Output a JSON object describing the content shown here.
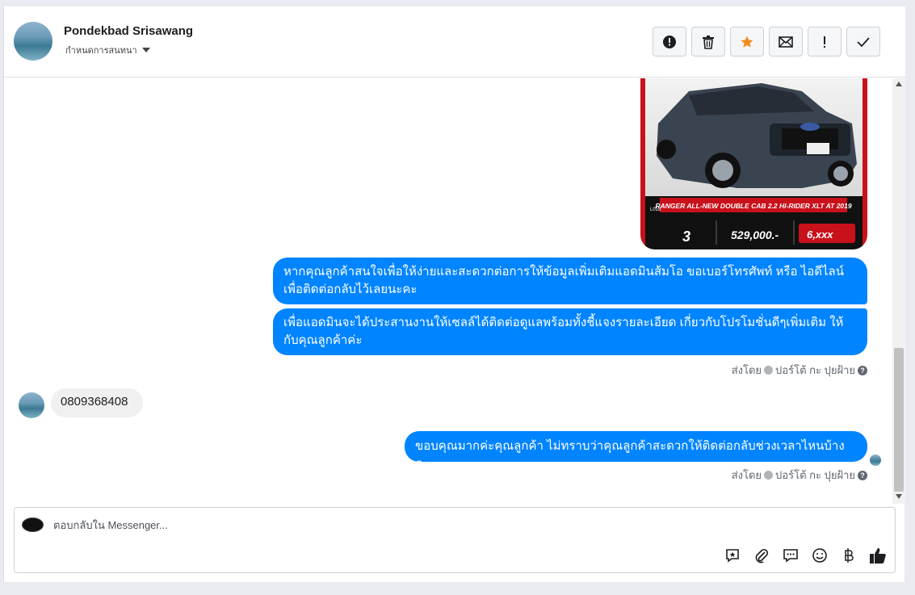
{
  "header": {
    "contact_name": "Pondekbad Srisawang",
    "assign_label": "กำหนดการสนทนา"
  },
  "actions": [
    {
      "name": "spam",
      "icon": "alert-circle-icon"
    },
    {
      "name": "delete",
      "icon": "trash-icon"
    },
    {
      "name": "star",
      "icon": "star-icon"
    },
    {
      "name": "mark-unread",
      "icon": "envelope-icon"
    },
    {
      "name": "important",
      "icon": "exclamation-icon"
    },
    {
      "name": "done",
      "icon": "check-icon"
    }
  ],
  "thread": {
    "promo_image": {
      "model_text": "RANGER ALL-NEW DOUBLE CAB 2.2 HI-RIDER XLT AT 2019",
      "price": "529,000.-",
      "years": "3",
      "down": "6,xxx",
      "code": "L018"
    },
    "outgoing_1": "หากคุณลูกค้าสนใจเพื่อให้ง่ายและสะดวกต่อการให้ข้อมูลเพิ่มเติมแอดมินส้มโอ ขอเบอร์โทรศัพท์ หรือ ไอดีไลน์ เพื่อติดต่อกลับไว้เลยนะคะ",
    "outgoing_2": "เพื่อแอดมินจะได้ประสานงานให้เซลล์ได้ติดต่อดูแลพร้อมทั้งชี้แจงรายละเอียด เกี่ยวกับโปรโมชั่นดีๆเพิ่มเติม ให้กับคุณลูกค้าค่ะ",
    "sent_by_1": "ส่งโดย",
    "sender_1": "ปอร์โต้ กะ ปุยฝ้าย",
    "incoming_1": "0809368408",
    "outgoing_3": "ขอบคุณมากค่ะคุณลูกค้า ไม่ทราบว่าคุณลูกค้าสะดวกให้ติดต่อกลับช่วงเวลาไหนบ้างคะ",
    "sent_by_2": "ส่งโดย",
    "sender_2": "ปอร์โต้ กะ ปุยฝ้าย"
  },
  "composer": {
    "placeholder": "ตอบกลับใน Messenger...",
    "tools": [
      "saved-reply-icon",
      "attachment-icon",
      "quick-reply-icon",
      "emoji-icon",
      "baht-icon",
      "thumbs-up-icon"
    ]
  },
  "colors": {
    "outgoing_bubble": "#0084ff",
    "incoming_bubble": "#f0f0f0",
    "star": "#f28b1b"
  }
}
